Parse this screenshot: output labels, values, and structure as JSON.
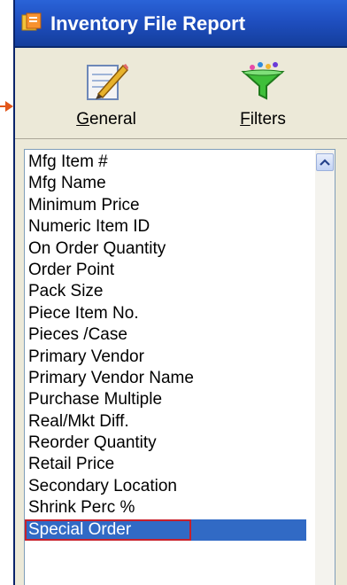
{
  "window": {
    "title": "Inventory File Report"
  },
  "toolbar": {
    "general_label": "General",
    "filters_label": "Filters"
  },
  "list": {
    "items": [
      "Mfg Item #",
      "Mfg Name",
      "Minimum Price",
      "Numeric Item ID",
      "On Order Quantity",
      "Order Point",
      "Pack Size",
      "Piece Item No.",
      "Pieces /Case",
      "Primary Vendor",
      "Primary Vendor Name",
      "Purchase Multiple",
      "Real/Mkt Diff.",
      "Reorder Quantity",
      "Retail Price",
      "Secondary Location",
      "Shrink Perc %",
      "Special Order"
    ],
    "selected_index": 17
  },
  "colors": {
    "title_bar": "#1f4fc0",
    "selection": "#316ac5",
    "highlight_box": "#c8202a",
    "annotation_arrow": "#e2561a"
  },
  "icons": {
    "general": "notepad-pencil-icon",
    "filters": "funnel-icon",
    "app": "app-icon",
    "scroll_up": "chevron-up-icon"
  }
}
